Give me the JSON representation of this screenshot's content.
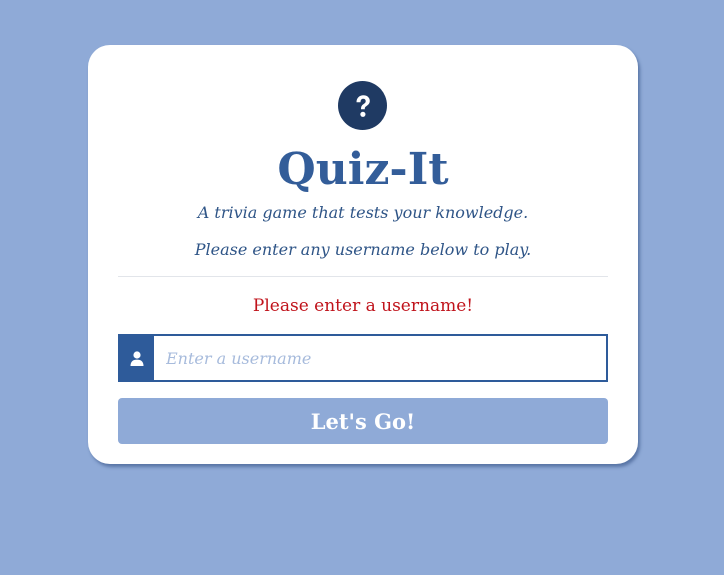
{
  "colors": {
    "page_background": "#8faad7",
    "card_background": "#ffffff",
    "brand_blue": "#335d99",
    "logo_navy": "#1f3a63",
    "error_red": "#c0131b",
    "button_background": "#8faad7"
  },
  "logo": {
    "icon": "question-circle-icon"
  },
  "header": {
    "title": "Quiz-It",
    "subtitle": "A trivia game that tests your knowledge.",
    "instructions": "Please enter any username below to play."
  },
  "form": {
    "error_message": "Please enter a username!",
    "username": {
      "icon": "user-icon",
      "value": "",
      "placeholder": "Enter a username"
    },
    "submit_label": "Let's Go!"
  }
}
